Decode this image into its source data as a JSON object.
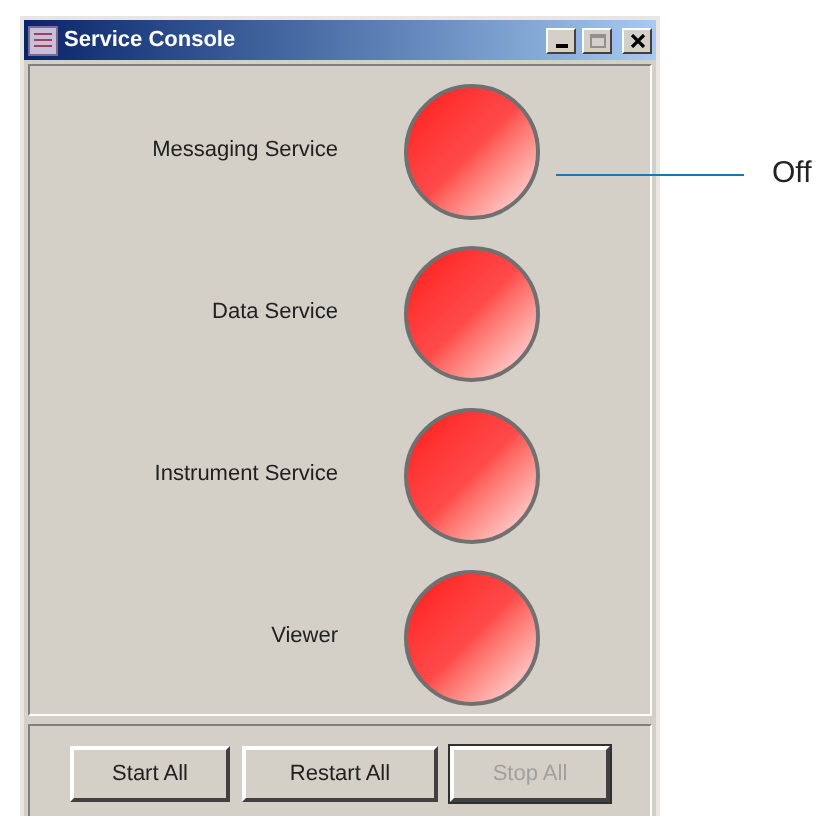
{
  "window": {
    "title": "Service Console"
  },
  "services": [
    {
      "name": "Messaging Service",
      "on": false
    },
    {
      "name": "Data Service",
      "on": false
    },
    {
      "name": "Instrument Service",
      "on": false
    },
    {
      "name": "Viewer",
      "on": false
    }
  ],
  "buttons": [
    {
      "label": "Start All",
      "disabled": false
    },
    {
      "label": "Restart All",
      "disabled": false
    },
    {
      "label": "Stop All",
      "disabled": true
    }
  ],
  "callout": {
    "text": "Off"
  }
}
